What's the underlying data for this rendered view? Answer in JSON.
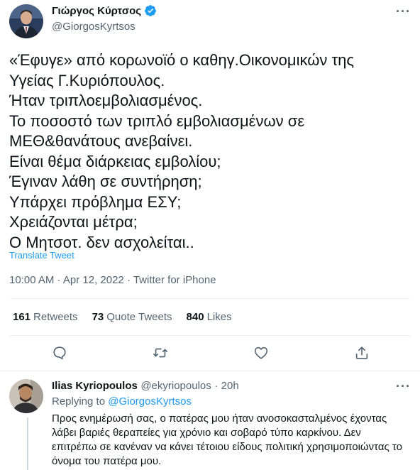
{
  "tweet": {
    "author_name": "Γιώργος Κύρτσος",
    "author_handle": "@GiorgosKyrtsos",
    "verified": true,
    "text_lines": [
      "«Έφυγε» από κορωνοϊό ο καθηγ.Οικονομικών της",
      "Υγείας Γ.Κυριόπουλος.",
      "Ήταν τριπλοεμβολιασμένος.",
      "Το ποσοστό των τριπλό εμβολιασμένων σε",
      "ΜΕΘ&θανάτους ανεβαίνει.",
      "Είναι θέμα διάρκειας εμβολίου;",
      "Έγιναν λάθη σε συντήρηση;",
      "Υπάρχει πρόβλημα ΕΣΥ;",
      "Χρειάζονται μέτρα;",
      "Ο Μητσοτ. δεν ασχολείται.."
    ],
    "translate_label": "Translate Tweet",
    "timestamp": "10:00 AM · Apr 12, 2022 · Twitter for iPhone",
    "stats": {
      "retweets_count": "161",
      "retweets_label": "Retweets",
      "quotes_count": "73",
      "quotes_label": "Quote Tweets",
      "likes_count": "840",
      "likes_label": "Likes"
    },
    "actions": [
      "reply-icon",
      "retweet-icon",
      "like-icon",
      "share-icon"
    ]
  },
  "reply": {
    "author_name": "Ilias Kyriopoulos",
    "author_handle": "@ekyriopoulos",
    "separator": "·",
    "time": "20h",
    "replying_to_prefix": "Replying to",
    "replying_to_handle": "@GiorgosKyrtsos",
    "text": "Προς ενημέρωσή σας, ο πατέρας μου ήταν ανοσοκασταλμένος έχοντας λάβει βαριές θεραπείες για χρόνιο και σοβαρό τύπο καρκίνου. Δεν επιτρέπω σε κανέναν να κάνει τέτοιου είδους πολιτική χρησιμοποιώντας το όνομα του πατέρα μου."
  },
  "colors": {
    "accent": "#1d9bf0",
    "text": "#0f1419",
    "secondary": "#536471",
    "divider": "#eff3f4"
  }
}
